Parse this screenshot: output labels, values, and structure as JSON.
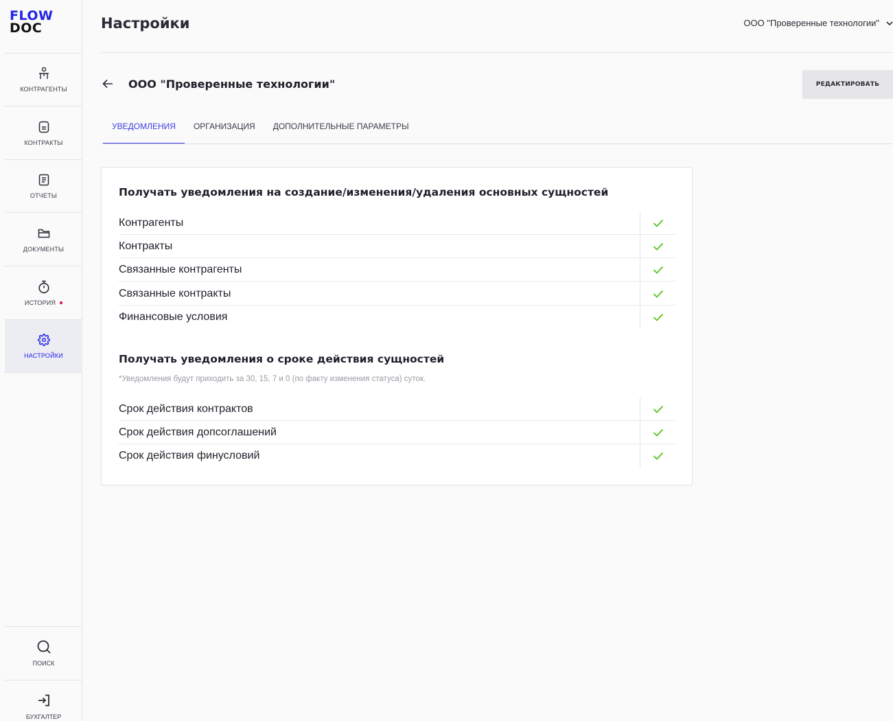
{
  "logo": {
    "line1": "FLOW",
    "line2": "DOC"
  },
  "nav": {
    "items": [
      {
        "label": "КОНТРАГЕНТЫ",
        "icon": "person-icon"
      },
      {
        "label": "КОНТРАКТЫ",
        "icon": "contract-icon"
      },
      {
        "label": "ОТЧЕТЫ",
        "icon": "report-icon"
      },
      {
        "label": "ДОКУМЕНТЫ",
        "icon": "folder-icon"
      },
      {
        "label": "ИСТОРИЯ",
        "icon": "stopwatch-icon"
      },
      {
        "label": "НАСТРОЙКИ",
        "icon": "gear-icon",
        "active": true
      }
    ],
    "bottom": [
      {
        "label": "ПОИСК",
        "icon": "search-icon"
      },
      {
        "label": "БУХГАЛТЕР",
        "icon": "login-icon"
      }
    ]
  },
  "header": {
    "title": "Настройки",
    "org_select": "ООО \"Проверенные технологии\""
  },
  "org": {
    "name": "ООО \"Проверенные технологии\"",
    "edit_label": "РЕДАКТИРОВАТЬ"
  },
  "tabs": [
    {
      "label": "УВЕДОМЛЕНИЯ",
      "active": true
    },
    {
      "label": "ОРГАНИЗАЦИЯ"
    },
    {
      "label": "ДОПОЛНИТЕЛЬНЫЕ ПАРАМЕТРЫ"
    }
  ],
  "section1": {
    "title": "Получать уведомления на создание/изменения/удаления основных сущностей",
    "rows": [
      {
        "label": "Контрагенты",
        "checked": true
      },
      {
        "label": "Контракты",
        "checked": true
      },
      {
        "label": "Связанные контрагенты",
        "checked": true
      },
      {
        "label": "Связанные контракты",
        "checked": true
      },
      {
        "label": "Финансовые условия",
        "checked": true
      }
    ]
  },
  "section2": {
    "title": "Получать уведомления о сроке действия сущностей",
    "note": "*Уведомления будут приходить за 30, 15, 7 и 0 (по факту изменения статуса) суток.",
    "rows": [
      {
        "label": "Срок действия контрактов",
        "checked": true
      },
      {
        "label": "Срок действия допсоглашений",
        "checked": true
      },
      {
        "label": "Срок действия финусловий",
        "checked": true
      }
    ]
  },
  "colors": {
    "brand": "#2323e6",
    "accent": "#3d3de0",
    "check": "#52c41a",
    "badge": "#e0245e"
  }
}
